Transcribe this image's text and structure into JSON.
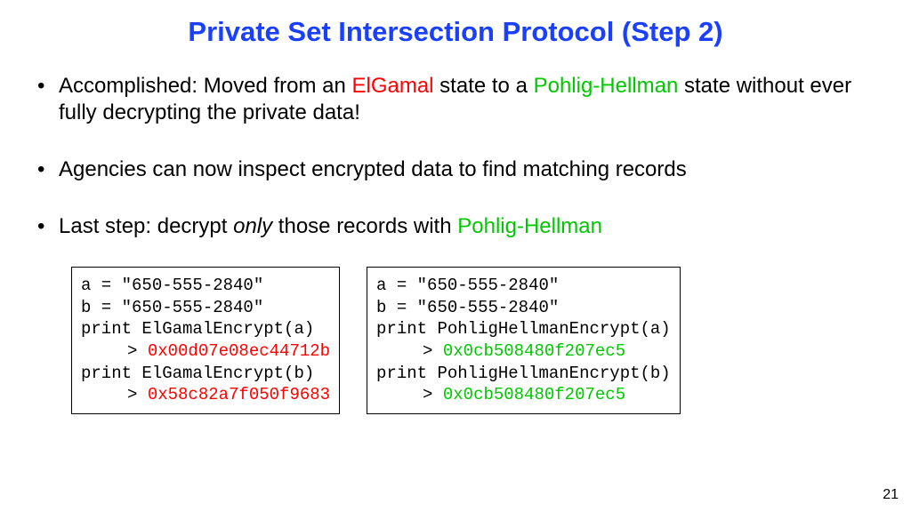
{
  "title": "Private Set Intersection Protocol (Step 2)",
  "bullets": {
    "b1": {
      "t1": "Accomplished: Moved from an ",
      "elgamal": "ElGamal",
      "t2": " state to a ",
      "pohlig": "Pohlig-Hellman",
      "t3": " state without ever fully decrypting the private data!"
    },
    "b2": {
      "t1": "Agencies can now inspect encrypted data to find matching records"
    },
    "b3": {
      "t1": "Last step: decrypt ",
      "only": "only",
      "t2": " those records with ",
      "pohlig": "Pohlig-Hellman"
    }
  },
  "code": {
    "left": {
      "l1": "a = \"650-555-2840\"",
      "l2": "b = \"650-555-2840\"",
      "l3": "print ElGamalEncrypt(a)",
      "l4p": "> ",
      "l4v": "0x00d07e08ec44712b",
      "l5": "print ElGamalEncrypt(b)",
      "l6p": "> ",
      "l6v": "0x58c82a7f050f9683"
    },
    "right": {
      "l1": "a = \"650-555-2840\"",
      "l2": "b = \"650-555-2840\"",
      "l3": "print PohligHellmanEncrypt(a)",
      "l4p": "> ",
      "l4v": "0x0cb508480f207ec5",
      "l5": "print PohligHellmanEncrypt(b)",
      "l6p": "> ",
      "l6v": "0x0cb508480f207ec5"
    }
  },
  "page_number": "21"
}
